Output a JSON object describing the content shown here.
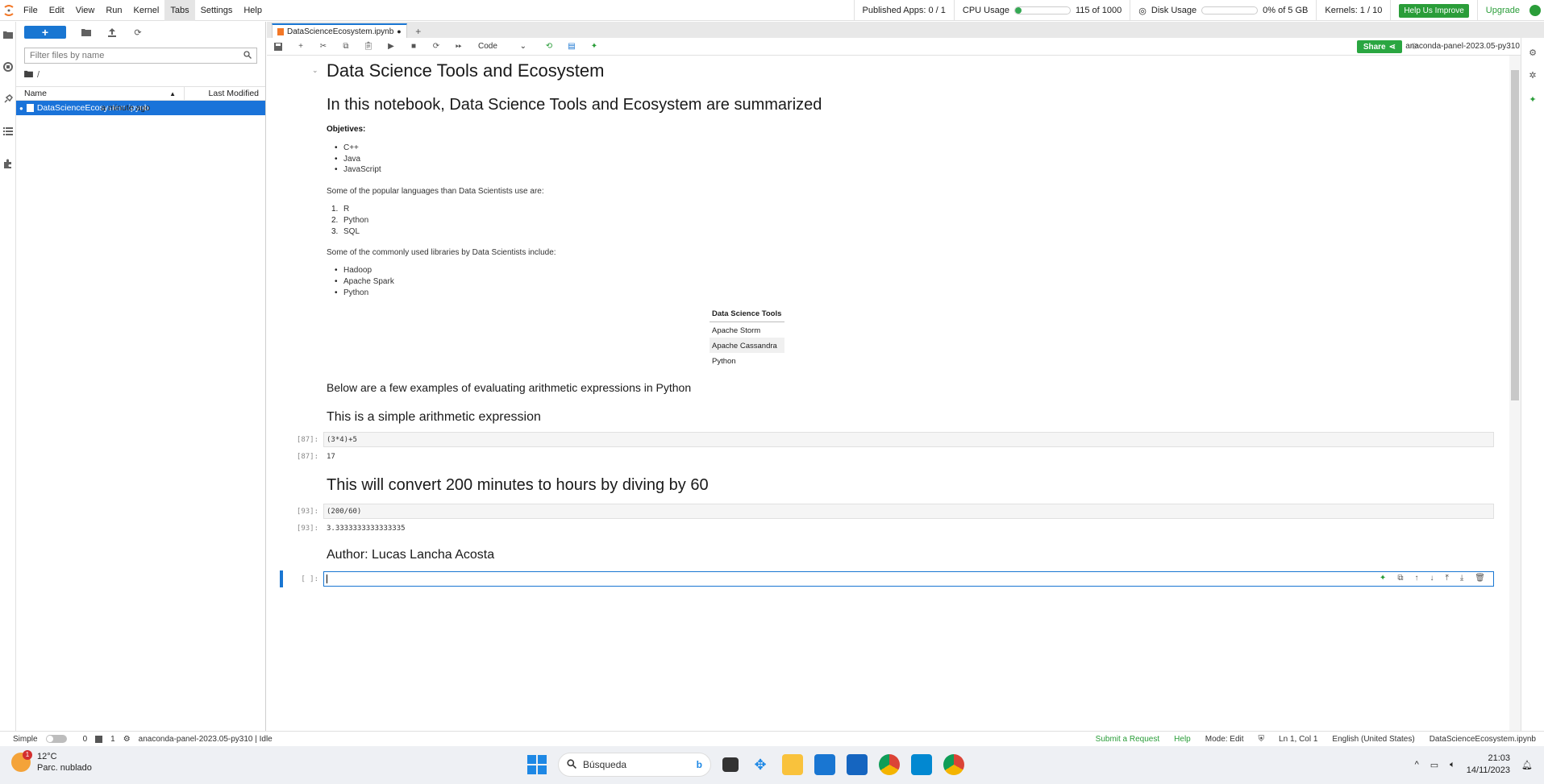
{
  "menu": [
    "File",
    "Edit",
    "View",
    "Run",
    "Kernel",
    "Tabs",
    "Settings",
    "Help"
  ],
  "topbar": {
    "published_apps": "Published Apps: 0 / 1",
    "cpu_label": "CPU Usage",
    "cpu_value": "115 of 1000",
    "cpu_fraction": 0.115,
    "disk_label": "Disk Usage",
    "disk_value": "0% of 5 GB",
    "kernels": "Kernels: 1 / 10",
    "help_improve": "Help Us Improve",
    "upgrade": "Upgrade"
  },
  "filebrowser": {
    "filter_placeholder": "Filter files by name",
    "path": "/",
    "col_name": "Name",
    "col_modified": "Last Modified",
    "files": [
      {
        "name": "DataScienceEcosystem.ipynb",
        "modified": "a minute ago"
      }
    ]
  },
  "tab": {
    "title": "DataScienceEcosystem.ipynb"
  },
  "nbtoolbar": {
    "cell_type": "Code",
    "share": "Share",
    "kernel": "anaconda-panel-2023.05-py310"
  },
  "notebook": {
    "title": "Data Science Tools and Ecosystem",
    "intro": "In this notebook, Data Science Tools and Ecosystem are summarized",
    "objectives_label": "Objetives:",
    "objectives": [
      "C++",
      "Java",
      "JavaScript"
    ],
    "languages_intro": "Some of the popular languages than Data Scientists use are:",
    "languages": [
      "R",
      "Python",
      "SQL"
    ],
    "libraries_intro": "Some of the commonly used libraries by Data Scientists include:",
    "libraries": [
      "Hadoop",
      "Apache Spark",
      "Python"
    ],
    "table_header": "Data Science Tools",
    "table_rows": [
      "Apache Storm",
      "Apache Cassandra",
      "Python"
    ],
    "arith_intro": "Below are a few examples of evaluating arithmetic expressions in Python",
    "simple_expr_heading": "This is a simple arithmetic expression",
    "cell1_prompt": "[87]:",
    "cell1_code": "(3*4)+5",
    "cell1_out_prompt": "[87]:",
    "cell1_out": "17",
    "convert_heading": "This will convert 200 minutes to hours by diving by 60",
    "cell2_prompt": "[93]:",
    "cell2_code": "(200/60)",
    "cell2_out_prompt": "[93]:",
    "cell2_out": "3.3333333333333335",
    "author": "Author: Lucas Lancha Acosta",
    "empty_prompt": "[ ]:"
  },
  "statusbar": {
    "mode_simple": "Simple",
    "count0": "0",
    "count1": "1",
    "kernel_status": "anaconda-panel-2023.05-py310 | Idle",
    "submit": "Submit a Request",
    "help": "Help",
    "mode": "Mode: Edit",
    "pos": "Ln 1, Col 1",
    "lang": "English (United States)",
    "file": "DataScienceEcosystem.ipynb"
  },
  "taskbar": {
    "temp": "12°C",
    "weather": "Parc. nublado",
    "badge": "1",
    "search": "Búsqueda",
    "time": "21:03",
    "date": "14/11/2023"
  }
}
